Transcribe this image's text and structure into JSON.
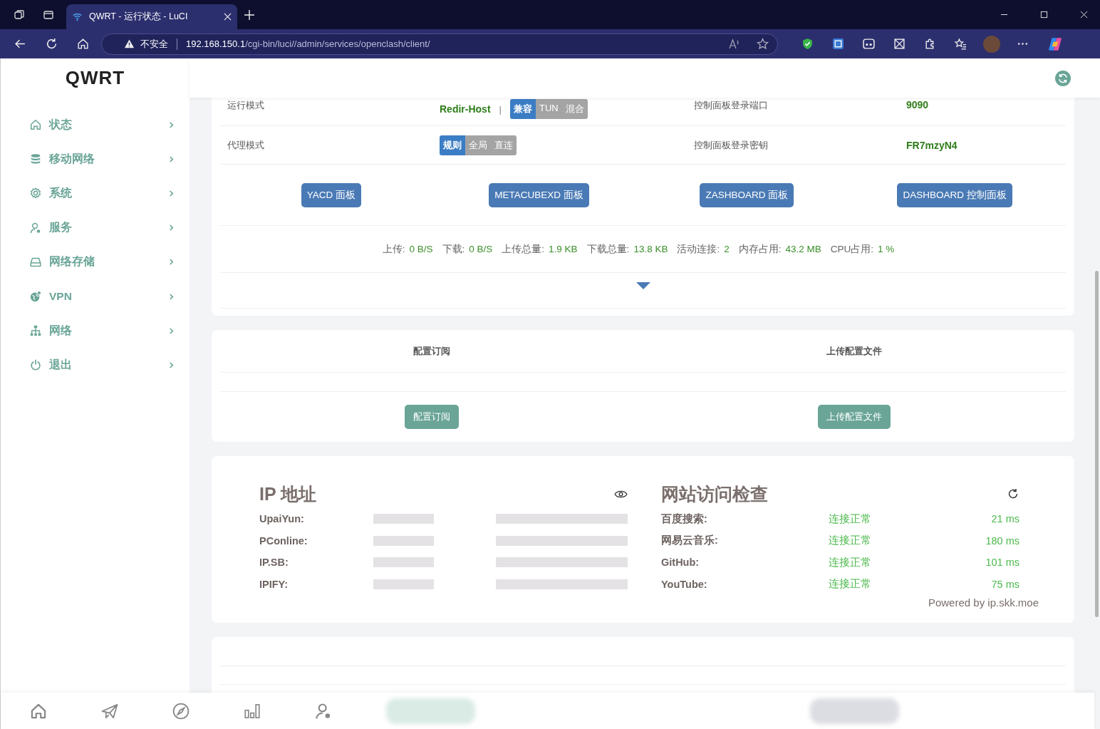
{
  "browser": {
    "tab_title": "QWRT - 运行状态 - LuCI",
    "security_label": "不安全",
    "url_host": "192.168.150.1",
    "url_path": "/cgi-bin/luci//admin/services/openclash/client/"
  },
  "sidebar": {
    "logo": "QWRT",
    "items": [
      {
        "label": "状态",
        "kind": "home"
      },
      {
        "label": "移动网络",
        "kind": "database"
      },
      {
        "label": "系统",
        "kind": "gear"
      },
      {
        "label": "服务",
        "kind": "user"
      },
      {
        "label": "网络存储",
        "kind": "drive"
      },
      {
        "label": "VPN",
        "kind": "globe"
      },
      {
        "label": "网络",
        "kind": "network"
      },
      {
        "label": "退出",
        "kind": "power"
      }
    ]
  },
  "status_rows": [
    {
      "label": "运行模式",
      "value": "Redir-Host",
      "separator": "|",
      "options": [
        {
          "label": "兼容",
          "selected": true
        },
        {
          "label": "TUN",
          "selected": false
        },
        {
          "label": "混合",
          "selected": false
        }
      ],
      "right_label": "控制面板登录端口",
      "right_value": "9090"
    },
    {
      "label": "代理模式",
      "options": [
        {
          "label": "规则",
          "selected": true
        },
        {
          "label": "全局",
          "selected": false
        },
        {
          "label": "直连",
          "selected": false
        }
      ],
      "right_label": "控制面板登录密钥",
      "right_value": "FR7mzyN4"
    }
  ],
  "panel_buttons": [
    "YACD 面板",
    "METACUBEXD 面板",
    "ZASHBOARD 面板",
    "DASHBOARD 控制面板"
  ],
  "stats": [
    {
      "label": "上传:",
      "value": "0 B/S"
    },
    {
      "label": "下载:",
      "value": "0 B/S"
    },
    {
      "label": "上传总量:",
      "value": "1.9 KB"
    },
    {
      "label": "下载总量:",
      "value": "13.8 KB"
    },
    {
      "label": "活动连接:",
      "value": "2"
    },
    {
      "label": "内存占用:",
      "value": "43.2 MB"
    },
    {
      "label": "CPU占用:",
      "value": "1 %"
    }
  ],
  "config": {
    "headers": [
      "配置订阅",
      "上传配置文件"
    ],
    "buttons": [
      "配置订阅",
      "上传配置文件"
    ]
  },
  "ip_check": {
    "title": "IP 地址",
    "rows": [
      {
        "name": "UpaiYun:"
      },
      {
        "name": "PConline:"
      },
      {
        "name": "IP.SB:"
      },
      {
        "name": "IPIFY:"
      }
    ]
  },
  "site_check": {
    "title": "网站访问检查",
    "rows": [
      {
        "name": "百度搜索:",
        "status": "连接正常",
        "latency": "21 ms"
      },
      {
        "name": "网易云音乐:",
        "status": "连接正常",
        "latency": "180 ms"
      },
      {
        "name": "GitHub:",
        "status": "连接正常",
        "latency": "101 ms"
      },
      {
        "name": "YouTube:",
        "status": "连接正常",
        "latency": "75 ms"
      }
    ],
    "footer": "Powered by ip.skk.moe"
  },
  "bottom_nav": [
    {
      "kind": "home"
    },
    {
      "kind": "plane"
    },
    {
      "kind": "compass"
    },
    {
      "kind": "bars"
    },
    {
      "kind": "user"
    }
  ]
}
